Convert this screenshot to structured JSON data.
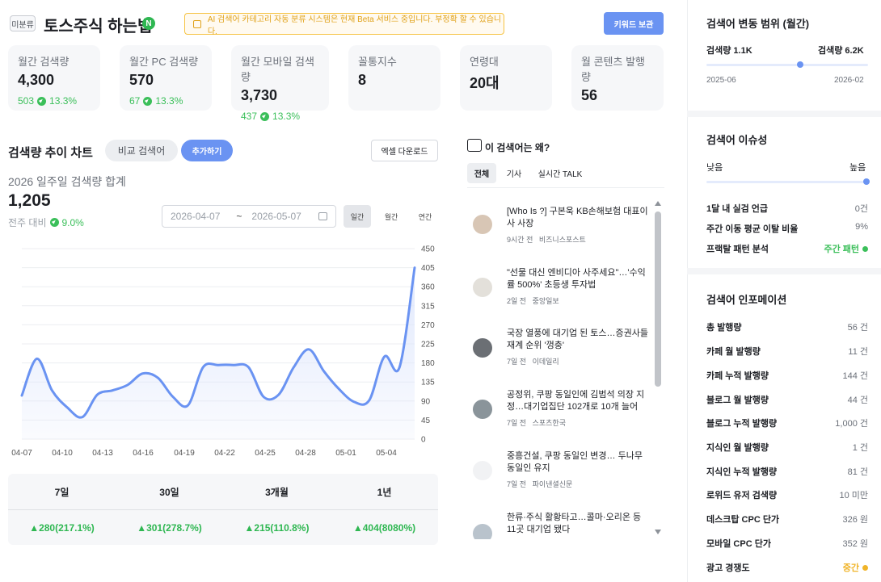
{
  "header": {
    "tag": "미분류",
    "keyword": "토스주식 하는법",
    "naver_badge": "N",
    "beta_notice": "AI 검색어 카테고리 자동 분류 시스템은 현재 Beta 서비스 중입니다. 부정확 할 수 있습니다.",
    "save_button": "키워드 보관"
  },
  "stats": [
    {
      "label": "월간 검색량",
      "value": "4,300",
      "delta": "503",
      "pct": "13.3%"
    },
    {
      "label": "월간 PC 검색량",
      "value": "570",
      "delta": "67",
      "pct": "13.3%"
    },
    {
      "label": "월간 모바일 검색량",
      "value": "3,730",
      "delta": "437",
      "pct": "13.3%"
    },
    {
      "label": "꼴통지수",
      "value": "8"
    },
    {
      "label": "연령대",
      "value": "20대"
    },
    {
      "label": "월 콘텐츠 발행량",
      "value": "56"
    }
  ],
  "trend": {
    "title": "검색량 추이 차트",
    "compare_button": "비교 검색어",
    "add_button": "추가하기",
    "excel_button": "엑셀 다운로드",
    "subtitle": "2026 일주일 검색량 합계",
    "total": "1,205",
    "wow_label": "전주 대비",
    "wow_value": "9.0%",
    "date_from": "2026-04-07",
    "date_sep": "~",
    "date_to": "2026-05-07",
    "periods": [
      "일간",
      "월간",
      "연간"
    ],
    "active_period": "일간"
  },
  "chart_data": {
    "type": "area",
    "x": [
      "04-07",
      "04-08",
      "04-09",
      "04-10",
      "04-11",
      "04-12",
      "04-13",
      "04-14",
      "04-15",
      "04-16",
      "04-17",
      "04-18",
      "04-19",
      "04-20",
      "04-21",
      "04-22",
      "04-23",
      "04-24",
      "04-25",
      "04-26",
      "04-27",
      "04-28",
      "04-29",
      "04-30",
      "05-01",
      "05-02",
      "05-03",
      "05-04",
      "05-05",
      "05-06",
      "05-07"
    ],
    "values": [
      103,
      190,
      115,
      75,
      52,
      105,
      115,
      128,
      155,
      145,
      100,
      80,
      170,
      175,
      175,
      170,
      100,
      105,
      170,
      212,
      160,
      118,
      88,
      92,
      195,
      170,
      405
    ],
    "x_ticks": [
      "04-07",
      "04-10",
      "04-13",
      "04-16",
      "04-19",
      "04-22",
      "04-25",
      "04-28",
      "05-01",
      "05-04"
    ],
    "y_ticks": [
      0,
      45,
      90,
      135,
      180,
      225,
      270,
      315,
      360,
      405,
      450
    ],
    "ylim": [
      0,
      450
    ],
    "color": "#6a93f2",
    "fill": "#dfe7fc",
    "grid": true
  },
  "periods_table": {
    "headers": [
      "7일",
      "30일",
      "3개월",
      "1년"
    ],
    "values": [
      "▲280(217.1%)",
      "▲301(278.7%)",
      "▲215(110.8%)",
      "▲404(8080%)"
    ]
  },
  "news": {
    "title": "이 검색어는 왜?",
    "tabs": [
      "전체",
      "기사",
      "실시간 TALK"
    ],
    "active_tab": "전체",
    "items": [
      {
        "title": "[Who Is ?] 구본욱 KB손해보험 대표이사 사장",
        "time": "9시간 전",
        "source": "비즈니스포스트"
      },
      {
        "title": "\"선물 대신 엔비디아 사주세요\"…'수익률 500%' 초등생 투자법",
        "time": "2일 전",
        "source": "중앙일보"
      },
      {
        "title": "국장 열풍에 대기업 된 토스…증권사들 재계 순위 '껑충'",
        "time": "7일 전",
        "source": "이데일리"
      },
      {
        "title": "공정위, 쿠팡 동일인에 김범석 의장 지정…대기업집단 102개로 10개 늘어",
        "time": "7일 전",
        "source": "스포츠한국"
      },
      {
        "title": "중흥건설, 쿠팡 동일인 변경… 두나무 동일인 유지",
        "time": "7일 전",
        "source": "파이낸셜신문"
      },
      {
        "title": "한류·주식 활황타고…콜마·오리온 등 11곳 대기업 됐다",
        "time": "",
        "source": ""
      }
    ]
  },
  "range": {
    "title": "검색어 변동 범위 (월간)",
    "min_label": "검색량 1.1K",
    "max_label": "검색량 6.2K",
    "from": "2025-06",
    "to": "2026-02",
    "marker_fraction": 0.58
  },
  "issue": {
    "title": "검색어 이슈성",
    "low": "낮음",
    "high": "높음",
    "level_fraction": 1.0,
    "rows": [
      {
        "k": "1달 내 실검 언급",
        "v": "0건"
      },
      {
        "k": "주간 이동 평균 이탈 비율",
        "v": "9%"
      },
      {
        "k": "프랙탈 패턴 분석",
        "v": "주간 패턴"
      }
    ]
  },
  "info": {
    "title": "검색어 인포메이션",
    "rows": [
      {
        "k": "총 발행량",
        "v": "56 건"
      },
      {
        "k": "카페 월 발행량",
        "v": "11 건"
      },
      {
        "k": "카페 누적 발행량",
        "v": "144 건"
      },
      {
        "k": "블로그 월 발행량",
        "v": "44 건"
      },
      {
        "k": "블로그 누적 발행량",
        "v": "1,000 건"
      },
      {
        "k": "지식인 월 발행량",
        "v": "1 건"
      },
      {
        "k": "지식인 누적 발행량",
        "v": "81 건"
      },
      {
        "k": "로위드 유저 검색량",
        "v": "10 미만"
      },
      {
        "k": "데스크탑 CPC 단가",
        "v": "326 원"
      },
      {
        "k": "모바일 CPC 단가",
        "v": "352 원"
      },
      {
        "k": "광고 경쟁도",
        "v": "중간"
      }
    ]
  },
  "colors": {
    "accent": "#6a93f2",
    "green": "#3bbf5a",
    "orange": "#f0b429"
  }
}
